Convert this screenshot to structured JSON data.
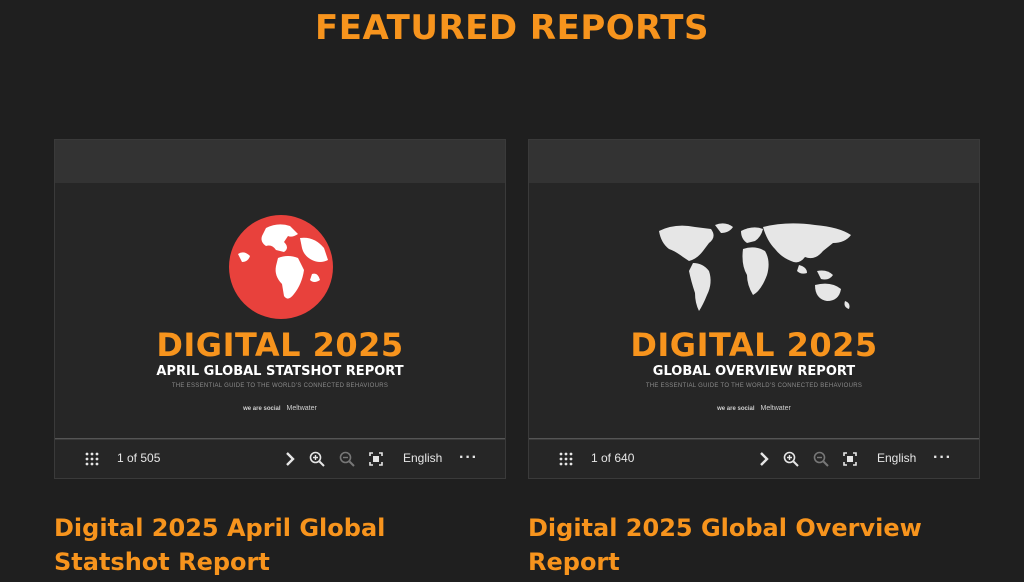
{
  "section": {
    "title": "FEATURED REPORTS"
  },
  "reports": [
    {
      "slide": {
        "headline": "DIGITAL 2025",
        "subtitle": "APRIL GLOBAL STATSHOT REPORT",
        "tagline": "THE ESSENTIAL GUIDE TO THE WORLD'S CONNECTED BEHAVIOURS",
        "brand_1": "we are social",
        "brand_2": "Meltwater"
      },
      "viewer": {
        "page_indicator": "1 of 505",
        "language": "English",
        "more": "···"
      },
      "title": "Digital 2025 April Global Statshot Report"
    },
    {
      "slide": {
        "headline": "DIGITAL 2025",
        "subtitle": "GLOBAL OVERVIEW REPORT",
        "tagline": "THE ESSENTIAL GUIDE TO THE WORLD'S CONNECTED BEHAVIOURS",
        "brand_1": "we are social",
        "brand_2": "Meltwater"
      },
      "viewer": {
        "page_indicator": "1 of 640",
        "language": "English",
        "more": "···"
      },
      "title": "Digital 2025 Global Overview Report"
    }
  ],
  "colors": {
    "accent": "#f7941d",
    "background": "#1f1f1f",
    "globe": "#e8413c"
  },
  "icons": [
    "grid-icon",
    "chevron-right-icon",
    "zoom-in-icon",
    "zoom-out-icon",
    "fullscreen-icon",
    "more-icon"
  ]
}
